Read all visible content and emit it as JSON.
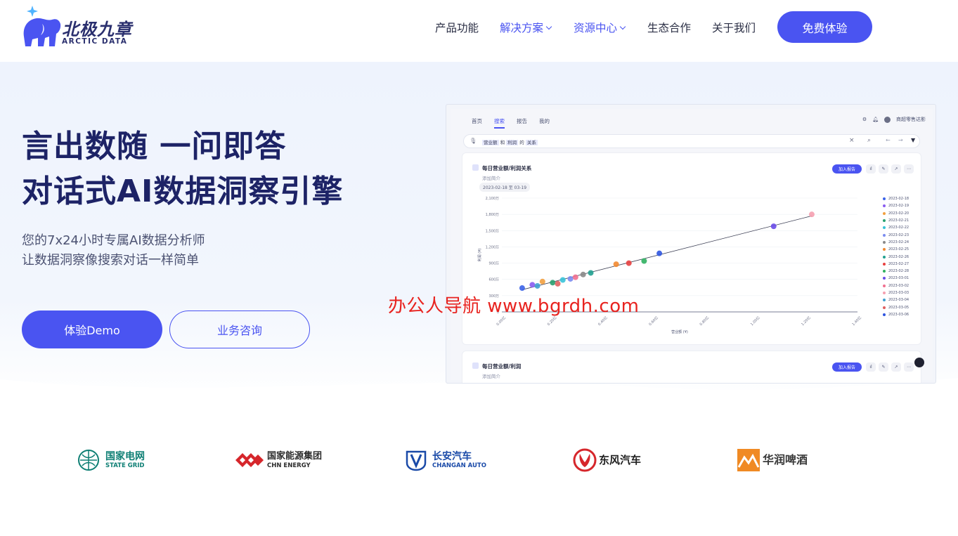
{
  "brand": {
    "name_cn": "北极九章",
    "name_en": "ARCTIC DATA"
  },
  "nav": {
    "items": [
      {
        "label": "产品功能",
        "dropdown": false,
        "active": false
      },
      {
        "label": "解决方案",
        "dropdown": true,
        "active": true
      },
      {
        "label": "资源中心",
        "dropdown": true,
        "active": true
      },
      {
        "label": "生态合作",
        "dropdown": false,
        "active": false
      },
      {
        "label": "关于我们",
        "dropdown": false,
        "active": false
      }
    ],
    "cta_label": "免费体验"
  },
  "hero": {
    "headline_line1": "言出数随 一问即答",
    "headline_line2": "对话式AI数据洞察引擎",
    "sub_line1": "您的7x24小时专属AI数据分析师",
    "sub_line2": "让数据洞察像搜索对话一样简单",
    "primary_button": "体验Demo",
    "secondary_button": "业务咨询"
  },
  "product_preview": {
    "tabs": [
      "首页",
      "搜索",
      "报告",
      "我的"
    ],
    "active_tab": "搜索",
    "user_label": "商超零售达影",
    "search_tokens": [
      "营业额",
      "和",
      "利润",
      "的",
      "关系"
    ],
    "card1": {
      "title": "每日营业额/利润关系",
      "desc": "添加简介",
      "date_range": "2023-02-18 至 03-19",
      "add_button": "加入报告",
      "chart_data": {
        "type": "scatter",
        "xlabel": "营业额 (¥)",
        "ylabel": "利润 (¥)",
        "y_ticks": [
          "2,100万",
          "1,800万",
          "1,500万",
          "1,200万",
          "900万",
          "600万",
          "300万",
          "0"
        ],
        "x_ticks": [
          "0.00亿",
          "0.20亿",
          "0.40亿",
          "0.60亿",
          "0.80亿",
          "1.00亿",
          "1.20亿",
          "1.40亿"
        ],
        "xlim": [
          0,
          1.4
        ],
        "ylim": [
          0,
          2100
        ],
        "series": [
          {
            "name": "2023-02-18",
            "color": "#3b63e8",
            "x": 0.08,
            "y": 440
          },
          {
            "name": "2023-02-19",
            "color": "#8a5cf0",
            "x": 0.12,
            "y": 500
          },
          {
            "name": "2023-02-20",
            "color": "#f2a040",
            "x": 0.16,
            "y": 560
          },
          {
            "name": "2023-02-21",
            "color": "#2aa070",
            "x": 0.2,
            "y": 540
          },
          {
            "name": "2023-02-22",
            "color": "#38c3d8",
            "x": 0.24,
            "y": 590
          },
          {
            "name": "2023-02-23",
            "color": "#7b8cf0",
            "x": 0.27,
            "y": 610
          },
          {
            "name": "2023-02-24",
            "color": "#8a8a8a",
            "x": 0.32,
            "y": 690
          },
          {
            "name": "2023-02-25",
            "color": "#f28a30",
            "x": 0.45,
            "y": 880
          },
          {
            "name": "2023-02-26",
            "color": "#20a090",
            "x": 0.35,
            "y": 720
          },
          {
            "name": "2023-02-27",
            "color": "#e84040",
            "x": 0.5,
            "y": 900
          },
          {
            "name": "2023-02-28",
            "color": "#30b060",
            "x": 0.56,
            "y": 940
          },
          {
            "name": "2023-03-01",
            "color": "#6a4de8",
            "x": 1.07,
            "y": 1580
          },
          {
            "name": "2023-03-02",
            "color": "#f07090",
            "x": 0.29,
            "y": 640
          },
          {
            "name": "2023-03-03",
            "color": "#f5a0b0",
            "x": 1.22,
            "y": 1800
          },
          {
            "name": "2023-03-04",
            "color": "#3fa0d0",
            "x": 0.14,
            "y": 480
          },
          {
            "name": "2023-03-05",
            "color": "#e06060",
            "x": 0.22,
            "y": 520
          },
          {
            "name": "2023-03-06",
            "color": "#2f55e0",
            "x": 0.62,
            "y": 1080
          }
        ],
        "trendline": true
      }
    },
    "card2": {
      "title": "每日营业额/利润",
      "desc": "添加简介",
      "add_button": "加入报告"
    }
  },
  "watermark": "办公人导航 www.bgrdh.com",
  "partners": [
    {
      "cn": "国家电网",
      "en": "STATE GRID",
      "color": "#0e7f74"
    },
    {
      "cn": "国家能源集团",
      "en": "CHN ENERGY",
      "color": "#2b2b2b"
    },
    {
      "cn": "长安汽车",
      "en": "CHANGAN AUTO",
      "color": "#1a4aa8"
    },
    {
      "cn": "东风汽车",
      "en": "",
      "color": "#1f1f1f"
    },
    {
      "cn": "华润啤酒",
      "en": "",
      "color": "#3a3a3a"
    }
  ]
}
